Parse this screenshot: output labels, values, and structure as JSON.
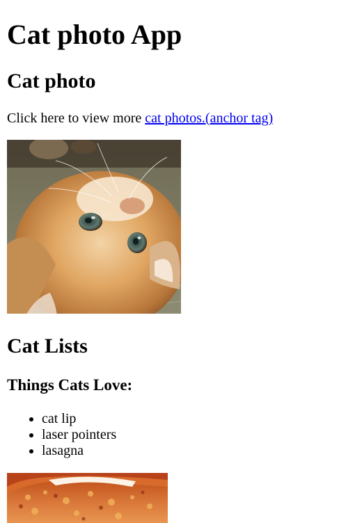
{
  "page": {
    "title": "Cat photo App"
  },
  "cat_photo_section": {
    "heading": "Cat photo",
    "intro_text": "Click here to view more ",
    "link_text": "cat photos.(anchor tag)",
    "image_alt": "A cute orange cat lying on its back."
  },
  "cat_lists_section": {
    "heading": "Cat Lists",
    "subheading": "Things Cats Love:",
    "items": [
      "cat lip",
      "laser pointers",
      "lasagna"
    ],
    "image_alt": "A slice of lasagna on a plate."
  },
  "colors": {
    "link": "#0000ee",
    "text": "#000000",
    "background": "#ffffff"
  }
}
